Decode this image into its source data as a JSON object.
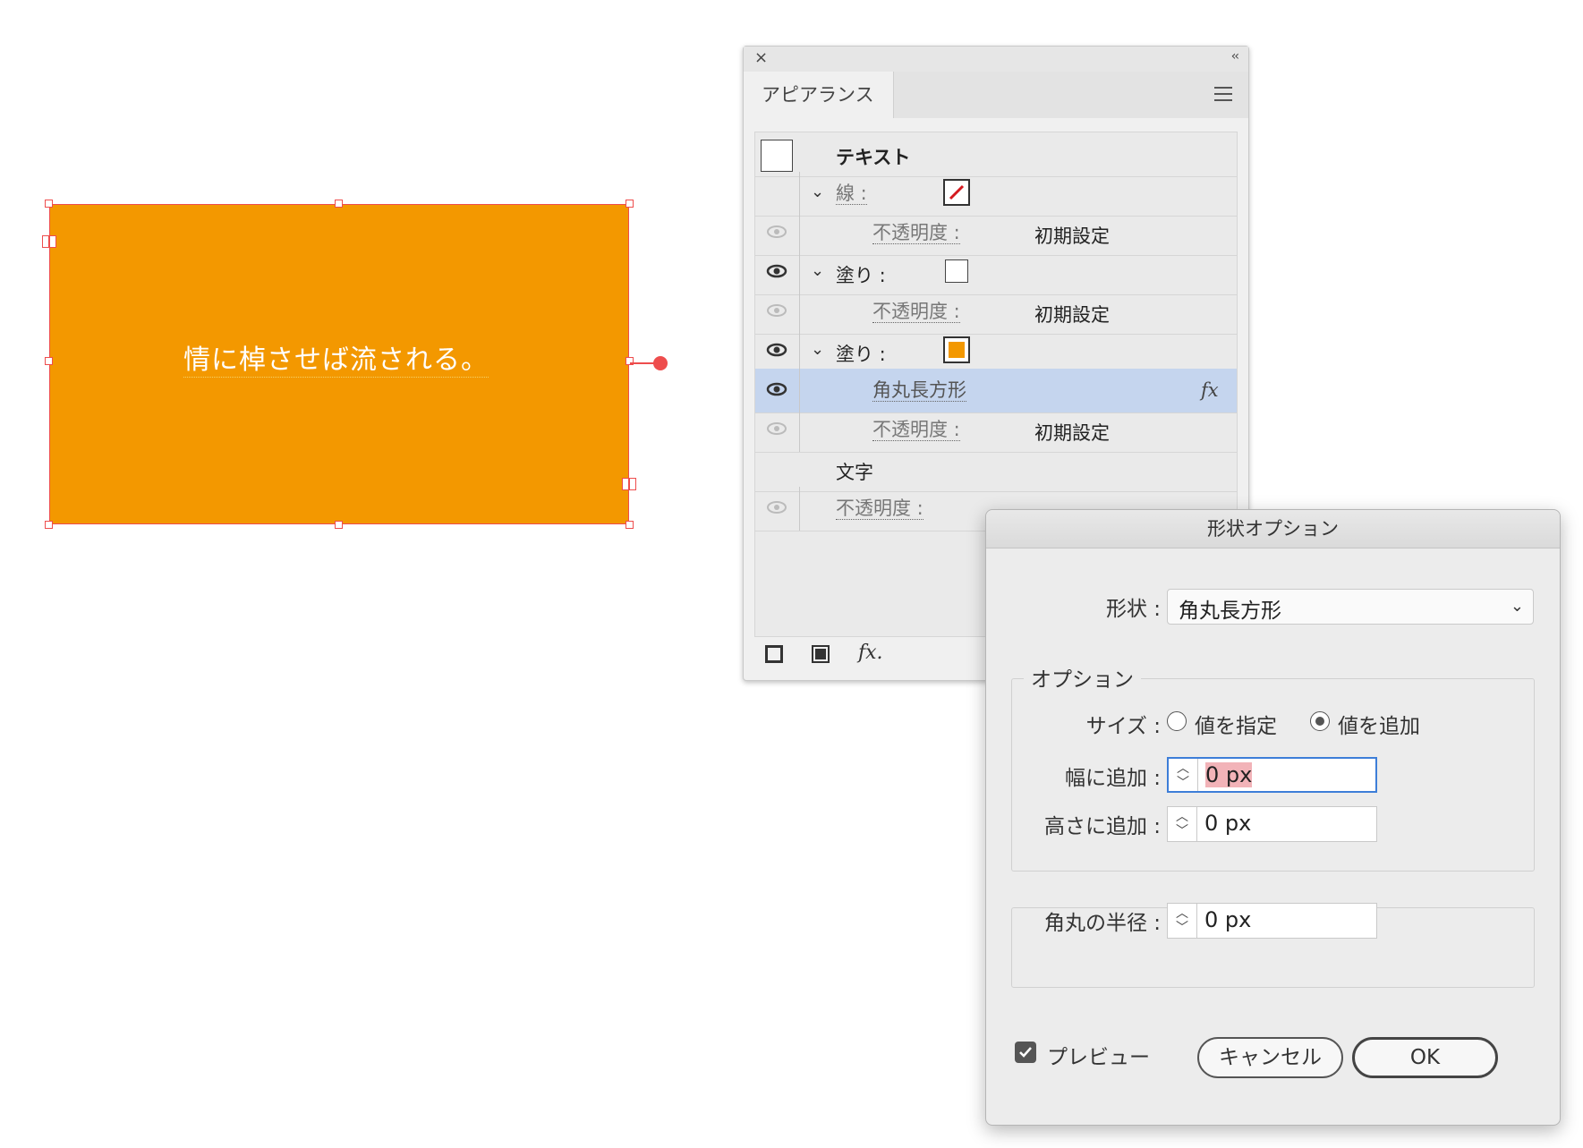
{
  "artboard": {
    "headline": "情に棹させば流される。",
    "fill_color": "#f39800",
    "selection_color": "#ee4d4d"
  },
  "appearance_panel": {
    "close_glyph": "×",
    "collapse_glyph": "‹‹",
    "tab_label": "アピアランス",
    "rows": {
      "text_title": "テキスト",
      "stroke_label": "線 :",
      "opacity_label": "不透明度 :",
      "opacity_value": "初期設定",
      "fill_label": "塗り :",
      "effect_label": "角丸長方形",
      "effect_fx": "fx",
      "characters_label": "文字"
    },
    "footer_fx": "fx."
  },
  "shape_options_dialog": {
    "title": "形状オプション",
    "shape_label": "形状 :",
    "shape_value": "角丸長方形",
    "options_legend": "オプション",
    "size_label": "サイズ :",
    "size_option_specify": "値を指定",
    "size_option_add": "値を追加",
    "size_selected": "値を追加",
    "width_label": "幅に追加 :",
    "width_value": "0 px",
    "height_label": "高さに追加 :",
    "height_value": "0 px",
    "radius_label": "角丸の半径 :",
    "radius_value": "0 px",
    "preview_label": "プレビュー",
    "preview_checked": true,
    "cancel_label": "キャンセル",
    "ok_label": "OK"
  },
  "colors": {
    "accent_blue": "#3d7ed8",
    "selected_row": "#c5d5ee",
    "highlight": "#f2b3b8"
  }
}
